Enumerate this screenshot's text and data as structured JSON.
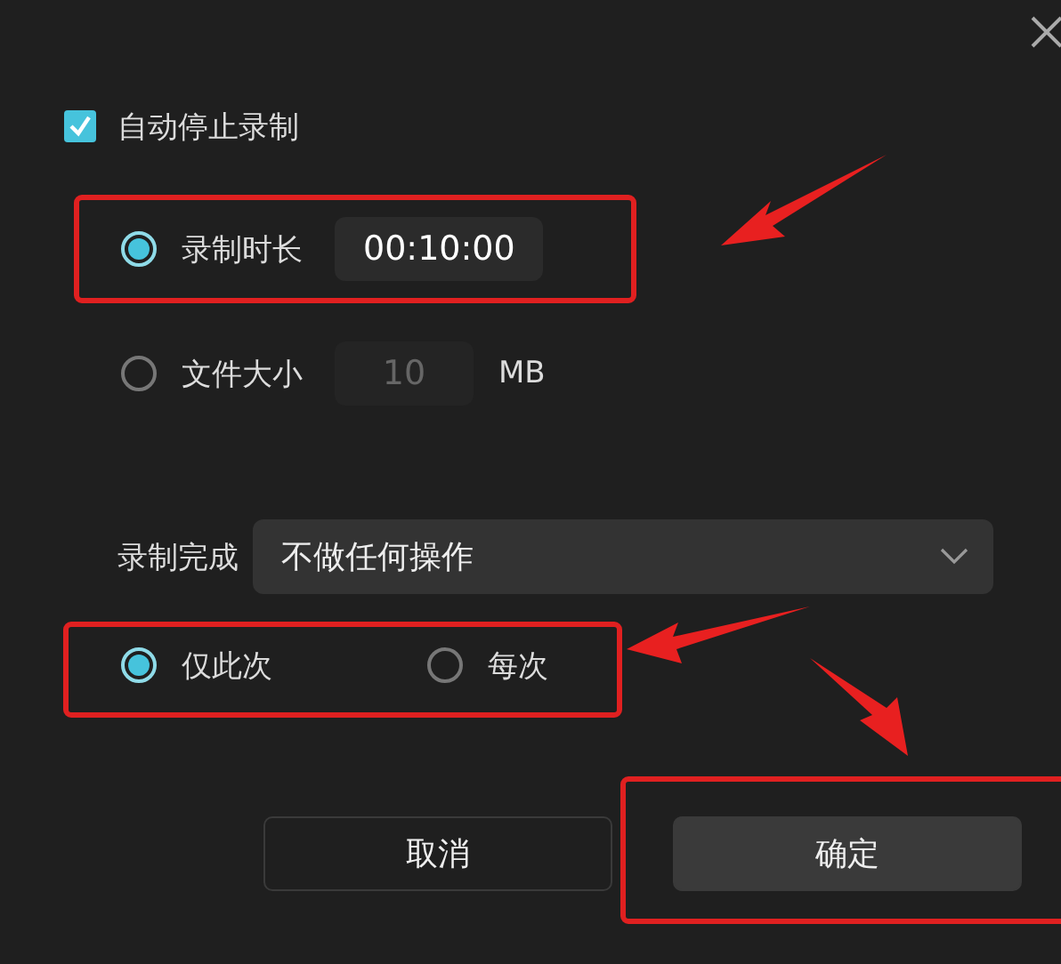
{
  "checkbox": {
    "label": "自动停止录制",
    "checked": true
  },
  "stop_conditions": [
    {
      "label": "录制时长",
      "selected": true,
      "value": "00:10:00"
    },
    {
      "label": "文件大小",
      "selected": false,
      "value": "10",
      "unit": "MB"
    }
  ],
  "on_complete": {
    "label": "录制完成",
    "value": "不做任何操作"
  },
  "scope": [
    {
      "label": "仅此次",
      "selected": true
    },
    {
      "label": "每次",
      "selected": false
    }
  ],
  "buttons": [
    "取消",
    "确定"
  ]
}
